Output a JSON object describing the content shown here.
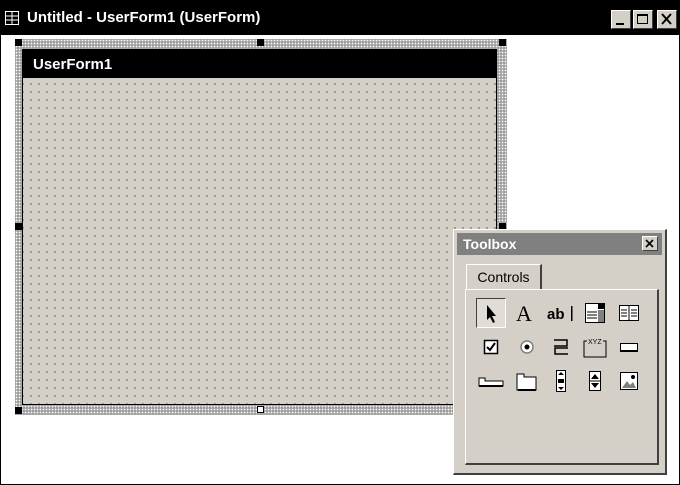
{
  "window": {
    "title": "Untitled - UserForm1 (UserForm)",
    "icon": "grid-window-icon",
    "controls": [
      "minimize-icon",
      "maximize-icon",
      "close-icon"
    ]
  },
  "userform": {
    "title": "UserForm1"
  },
  "toolbox": {
    "title": "Toolbox",
    "tab_label": "Controls",
    "tools": [
      {
        "name": "select-objects-icon",
        "glyph": "arrow"
      },
      {
        "name": "label-icon",
        "glyph": "A"
      },
      {
        "name": "textbox-icon",
        "glyph": "ab|"
      },
      {
        "name": "combobox-icon",
        "glyph": "combo"
      },
      {
        "name": "listbox-icon",
        "glyph": "list"
      },
      {
        "name": "checkbox-icon",
        "glyph": "check"
      },
      {
        "name": "optionbutton-icon",
        "glyph": "radio"
      },
      {
        "name": "togglebutton-icon",
        "glyph": "toggle"
      },
      {
        "name": "frame-icon",
        "glyph": "XYZ"
      },
      {
        "name": "commandbutton-icon",
        "glyph": "button"
      },
      {
        "name": "tabstrip-icon",
        "glyph": "tabstrip"
      },
      {
        "name": "multipage-icon",
        "glyph": "multipage"
      },
      {
        "name": "scrollbar-icon",
        "glyph": "scrollbar"
      },
      {
        "name": "spinbutton-icon",
        "glyph": "spin"
      },
      {
        "name": "image-icon",
        "glyph": "image"
      }
    ]
  }
}
